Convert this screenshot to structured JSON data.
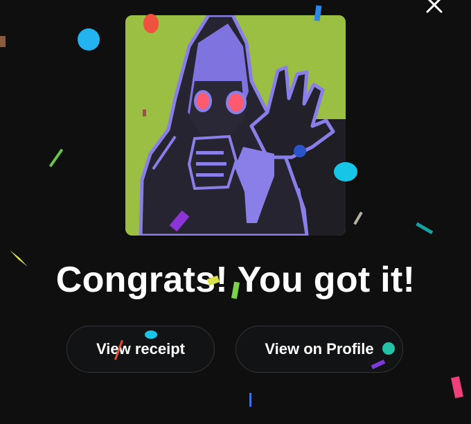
{
  "dialog": {
    "close_icon": "close-icon",
    "artwork_alt": "",
    "headline": "Congrats! You got it!",
    "buttons": {
      "view_receipt": "View receipt",
      "view_on_profile": "View on Profile"
    }
  },
  "colors": {
    "background": "#0f0f10",
    "artwork_green": "#9bbf43",
    "figure_purple": "#8a7fe8",
    "figure_dark": "#222028",
    "eyes": "#ff5a6e",
    "button_border": "#33353a",
    "text": "#ffffff"
  }
}
